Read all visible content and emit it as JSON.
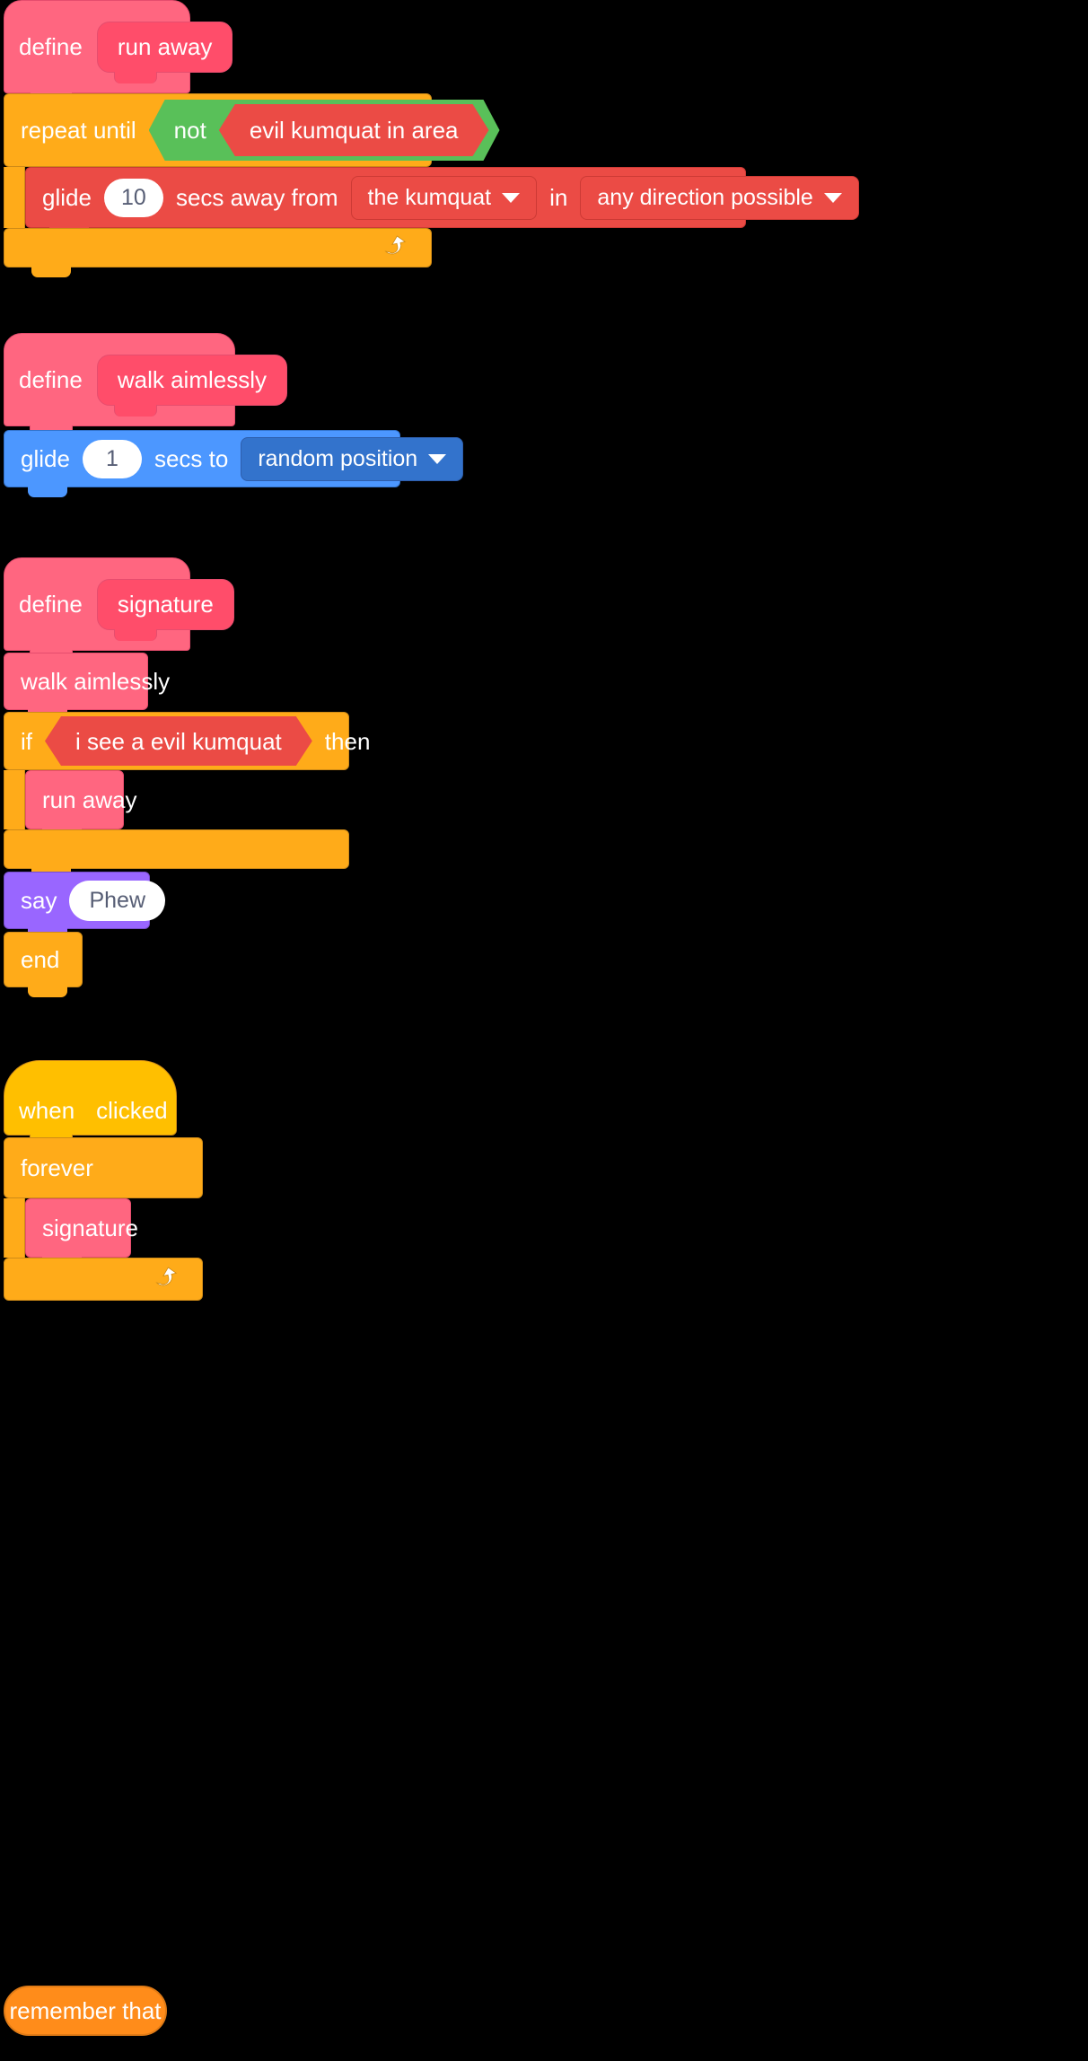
{
  "meta": {
    "app": "scratch-block-editor",
    "background": "#000000"
  },
  "palette": {
    "custom_block": "#FF6680",
    "custom_block_dark": "#FF4D6A",
    "control": "#FFAB19",
    "motion": "#4C97FF",
    "motion_dark": "#3373CC",
    "looks": "#9966FF",
    "sensing_red": "#EB4B45",
    "operator_green": "#59C059",
    "input_text": "#575E75",
    "orange_button": "#FF8C1A",
    "flag_green": "#4CBF56"
  },
  "scripts": [
    {
      "id": "script-run-away",
      "define": {
        "keyword": "define",
        "procedure": "run away"
      },
      "blocks": [
        {
          "type": "repeat-until",
          "label": "repeat until",
          "condition": {
            "type": "not",
            "label": "not",
            "operand": {
              "type": "boolean",
              "label": "evil kumquat in area"
            }
          },
          "body": [
            {
              "type": "glide-away",
              "parts": [
                "glide",
                "secs away from",
                "in"
              ],
              "secs": "10",
              "from_target": "the kumquat",
              "direction": "any direction possible",
              "dropdown_icon": "chevron-down-icon"
            }
          ],
          "loop_icon": "loop-arrow-icon"
        }
      ]
    },
    {
      "id": "script-walk-aimlessly",
      "define": {
        "keyword": "define",
        "procedure": "walk aimlessly"
      },
      "blocks": [
        {
          "type": "glide-to",
          "parts": [
            "glide",
            "secs to"
          ],
          "secs": "1",
          "target": "random position",
          "dropdown_icon": "chevron-down-icon"
        }
      ]
    },
    {
      "id": "script-signature",
      "define": {
        "keyword": "define",
        "procedure": "signature"
      },
      "blocks": [
        {
          "type": "call",
          "label": "walk aimlessly"
        },
        {
          "type": "if-then",
          "label_if": "if",
          "label_then": "then",
          "condition": {
            "type": "boolean",
            "label": "i see a evil kumquat"
          },
          "body": [
            {
              "type": "call",
              "label": "run away"
            }
          ]
        },
        {
          "type": "say",
          "label": "say",
          "message": "Phew"
        },
        {
          "type": "end",
          "label": "end"
        }
      ]
    },
    {
      "id": "script-main",
      "hat": {
        "prefix": "when",
        "suffix": "clicked",
        "icon": "green-flag-icon"
      },
      "blocks": [
        {
          "type": "forever",
          "label": "forever",
          "body": [
            {
              "type": "call",
              "label": "signature"
            }
          ],
          "loop_icon": "loop-arrow-icon"
        }
      ]
    }
  ],
  "footer_button": {
    "label": "remember that"
  }
}
